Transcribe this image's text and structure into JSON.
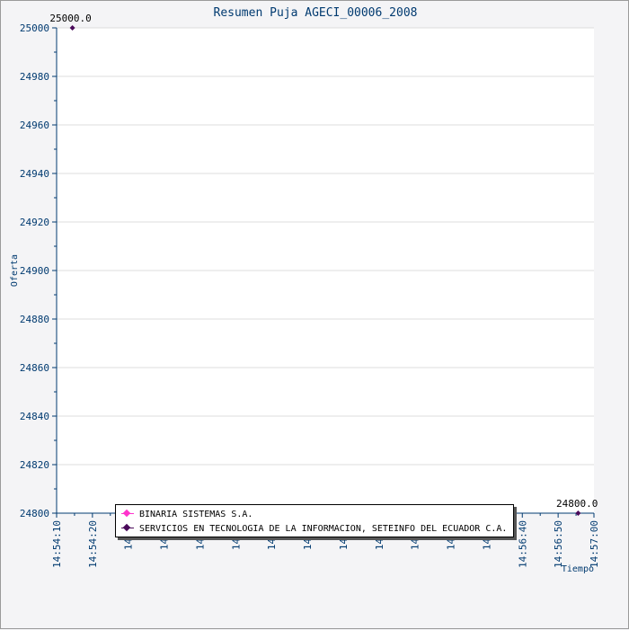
{
  "chart_data": {
    "type": "line",
    "title": "Resumen Puja AGECI_00006_2008",
    "xlabel": "Tiempo",
    "ylabel": "Oferta",
    "ylim": [
      24800,
      25000
    ],
    "y_ticks": [
      24800,
      24820,
      24840,
      24860,
      24880,
      24900,
      24920,
      24940,
      24960,
      24980,
      25000
    ],
    "x_ticks": [
      "14:54:10",
      "14:54:20",
      "14:54",
      "14:54",
      "14:55",
      "14:55",
      "14:55",
      "14:55",
      "14:55",
      "14:55",
      "14:56",
      "14:56",
      "14:56",
      "14:56:40",
      "14:56:50",
      "14:57:00"
    ],
    "x_range_seconds": [
      0,
      170
    ],
    "grid": true,
    "legend_position": "bottom",
    "series": [
      {
        "name": "BINARIA SISTEMAS S.A.",
        "color": "#ff33cc",
        "points": []
      },
      {
        "name": "SERVICIOS EN TECNOLOGIA DE LA INFORMACION, SETEINFO DEL ECUADOR C.A.",
        "color": "#4a0a5a",
        "points": [
          {
            "x": "14:54:15",
            "y": 25000.0,
            "label": "25000.0"
          },
          {
            "x": "14:56:55",
            "y": 24800.0,
            "label": "24800.0"
          }
        ]
      }
    ]
  }
}
